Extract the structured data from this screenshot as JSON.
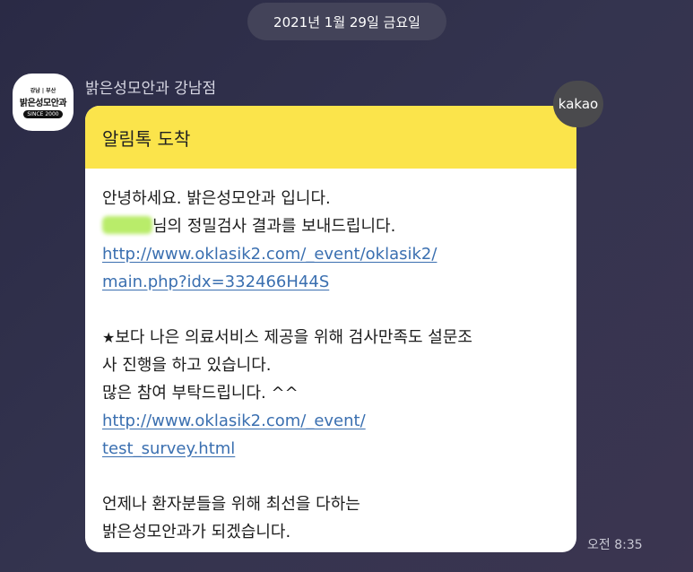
{
  "date_divider": "2021년 1월 29일 금요일",
  "sender": {
    "name": "밝은성모안과 강남점",
    "avatar": {
      "top_text": "강남 | 부산",
      "main_text": "밝은성모안과",
      "since_text": "SINCE 2000"
    }
  },
  "kakao_badge": "kakao",
  "message": {
    "header": "알림톡 도착",
    "line1": "안녕하세요. 밝은성모안과 입니다.",
    "line2_suffix": "님의 정밀검사 결과를 보내드립니다.",
    "link1_part1": "http://www.oklasik2.com/_event/oklasik2/",
    "link1_part2": "main.php?idx=332466H44S",
    "star_icon": "★",
    "line3": "보다 나은 의료서비스 제공을 위해 검사만족도 설문조",
    "line4": "사 진행을 하고 있습니다.",
    "line5": "많은 참여 부탁드립니다. ^^",
    "link2_part1": "http://www.oklasik2.com/_event/",
    "link2_part2": "test_survey.html",
    "line6": "언제나 환자분들을 위해 최선을 다하는",
    "line7": "밝은성모안과가 되겠습니다."
  },
  "timestamp": "오전 8:35",
  "colors": {
    "header_yellow": "#fbe44b",
    "link_blue": "#3a6fb0",
    "background": "#2a2a45"
  }
}
